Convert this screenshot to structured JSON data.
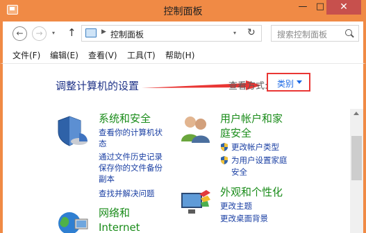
{
  "window": {
    "title": "控制面板",
    "minimize_icon": "minimize-icon",
    "maximize_icon": "maximize-icon",
    "close_icon": "close-icon",
    "minimize_glyph": "—",
    "maximize_glyph": "□",
    "close_glyph": "✕"
  },
  "nav": {
    "back_glyph": "←",
    "forward_glyph": "→",
    "up_glyph": "↑",
    "dropdown_glyph": "▾",
    "refresh_glyph": "↻"
  },
  "address": {
    "breadcrumb_sep": "▶",
    "breadcrumb": "控制面板"
  },
  "search": {
    "placeholder": "搜索控制面板"
  },
  "menu": {
    "file": "文件(F)",
    "edit": "编辑(E)",
    "view": "查看(V)",
    "tools": "工具(T)",
    "help": "帮助(H)"
  },
  "content": {
    "heading": "调整计算机的设置",
    "view_by_label": "查看方式:",
    "view_by_value": "类别",
    "annotation_color": "#e93634"
  },
  "categories": {
    "system": {
      "title": "系统和安全",
      "links": [
        "查看你的计算机状态",
        "通过文件历史记录保存你的文件备份副本",
        "查找并解决问题"
      ],
      "link_lines": [
        "查看你的计算机状",
        "态",
        "通过文件历史记录",
        "保存你的文件备份",
        "副本",
        "查找并解决问题"
      ]
    },
    "user": {
      "title_line1": "用户帐户和家",
      "title_line2": "庭安全",
      "links": [
        "更改帐户类型",
        "为用户设置家庭安全"
      ],
      "link_lines": [
        "更改帐户类型",
        "为用户设置家庭",
        "安全"
      ]
    },
    "network": {
      "title_line1": "网络和",
      "title_line2": "Internet"
    },
    "appearance": {
      "title": "外观和个性化",
      "links": [
        "更改主题",
        "更改桌面背景"
      ]
    }
  },
  "colors": {
    "titlebar": "#f08a45",
    "category_title": "#1a8c1a",
    "link": "#1a3fa3",
    "heading": "#1e3287"
  }
}
